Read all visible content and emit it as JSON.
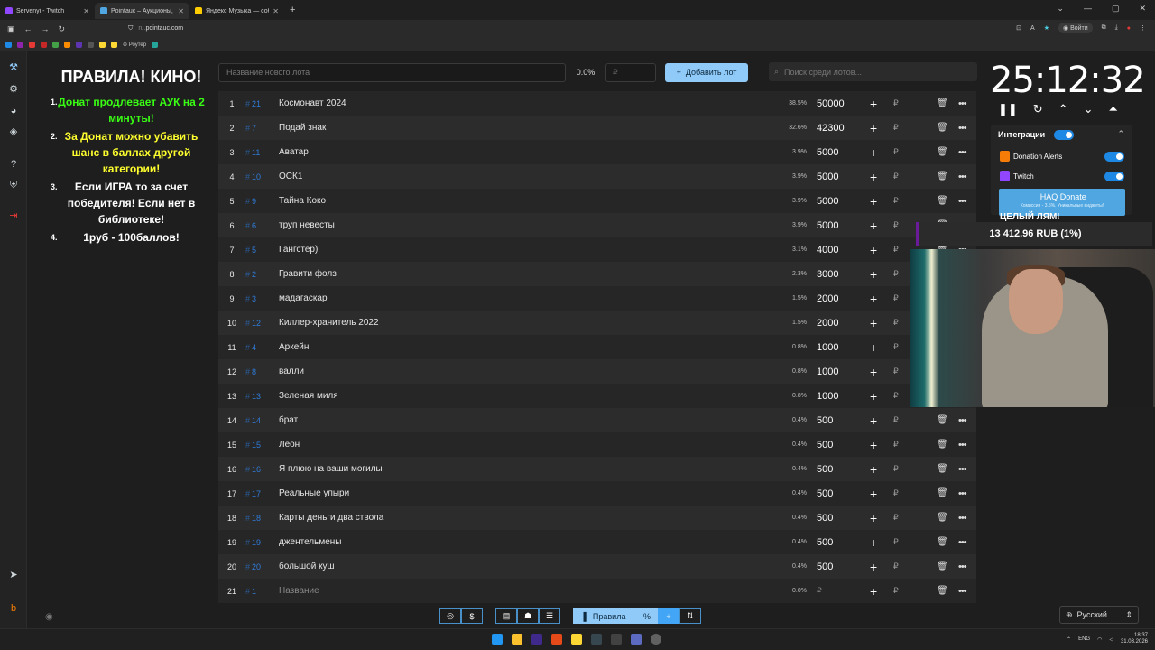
{
  "browser": {
    "tabs": [
      {
        "label": "Servenyi - Twitch",
        "color": "#9146ff"
      },
      {
        "label": "Pointauc – Аукционы, лотереи",
        "color": "#4fa6e0"
      },
      {
        "label": "Яндекс Музыка — собира",
        "color": "#ffcc00"
      }
    ],
    "url_prefix": "ru.",
    "url_domain": "pointauc.com",
    "login_label": "Войти",
    "bookmark_router": "Роутер"
  },
  "rules": {
    "title": "ПРАВИЛА! КИНО!",
    "items": [
      {
        "num": "1.",
        "a": "Донат продлевает АУК на 2 минуты!"
      },
      {
        "num": "2.",
        "a": "За Донат можно убавить шанс в баллах другой категории!"
      },
      {
        "num": "3.",
        "a": "Если ИГРА то за счет победителя! Если нет в библиотеке!"
      },
      {
        "num": "4.",
        "a": "1руб - 100баллов!"
      }
    ]
  },
  "toolbar": {
    "lot_placeholder": "Название нового лота",
    "percent": "0.0%",
    "amount_placeholder": "₽",
    "add_label": "Добавить лот",
    "search_placeholder": "Поиск среди лотов..."
  },
  "lots": [
    {
      "idx": "1",
      "id": "21",
      "name": "Космонавт 2024",
      "pct": "38.5%",
      "amount": "50000"
    },
    {
      "idx": "2",
      "id": "7",
      "name": "Подай знак",
      "pct": "32.6%",
      "amount": "42300"
    },
    {
      "idx": "3",
      "id": "11",
      "name": "Аватар",
      "pct": "3.9%",
      "amount": "5000"
    },
    {
      "idx": "4",
      "id": "10",
      "name": "ОСК1",
      "pct": "3.9%",
      "amount": "5000"
    },
    {
      "idx": "5",
      "id": "9",
      "name": "Тайна Коко",
      "pct": "3.9%",
      "amount": "5000"
    },
    {
      "idx": "6",
      "id": "6",
      "name": "труп невесты",
      "pct": "3.9%",
      "amount": "5000"
    },
    {
      "idx": "7",
      "id": "5",
      "name": "Гангстер)",
      "pct": "3.1%",
      "amount": "4000"
    },
    {
      "idx": "8",
      "id": "2",
      "name": "Гравити фолз",
      "pct": "2.3%",
      "amount": "3000"
    },
    {
      "idx": "9",
      "id": "3",
      "name": "мадагаскар",
      "pct": "1.5%",
      "amount": "2000"
    },
    {
      "idx": "10",
      "id": "12",
      "name": "Киллер-хранитель 2022",
      "pct": "1.5%",
      "amount": "2000"
    },
    {
      "idx": "11",
      "id": "4",
      "name": "Аркейн",
      "pct": "0.8%",
      "amount": "1000"
    },
    {
      "idx": "12",
      "id": "8",
      "name": "валли",
      "pct": "0.8%",
      "amount": "1000"
    },
    {
      "idx": "13",
      "id": "13",
      "name": "Зеленая миля",
      "pct": "0.8%",
      "amount": "1000"
    },
    {
      "idx": "14",
      "id": "14",
      "name": "брат",
      "pct": "0.4%",
      "amount": "500"
    },
    {
      "idx": "15",
      "id": "15",
      "name": "Леон",
      "pct": "0.4%",
      "amount": "500"
    },
    {
      "idx": "16",
      "id": "16",
      "name": "Я плюю на ваши могилы",
      "pct": "0.4%",
      "amount": "500"
    },
    {
      "idx": "17",
      "id": "17",
      "name": "Реальные упыри",
      "pct": "0.4%",
      "amount": "500"
    },
    {
      "idx": "18",
      "id": "18",
      "name": "Карты деньги два ствола",
      "pct": "0.4%",
      "amount": "500"
    },
    {
      "idx": "19",
      "id": "19",
      "name": "джентельмены",
      "pct": "0.4%",
      "amount": "500"
    },
    {
      "idx": "20",
      "id": "20",
      "name": "большой куш",
      "pct": "0.4%",
      "amount": "500"
    },
    {
      "idx": "21",
      "id": "1",
      "name": "Название",
      "pct": "0.0%",
      "amount": "₽"
    }
  ],
  "timer": {
    "value": "25:12:32"
  },
  "integrations": {
    "title": "Интеграции",
    "donation_alerts": "Donation Alerts",
    "twitch": "Twitch",
    "ihaq_title": "IHAQ Donate",
    "ihaq_sub": "Комиссия - 3.5%. Уникальные виджеты!"
  },
  "overlay": {
    "goal": "ЦЕЛЫЙ ЛЯМ!",
    "donation": "13 412.96 RUB (1%)"
  },
  "bottom": {
    "rules_label": "Правила",
    "percent_sign": "%",
    "dollar_sign": "$"
  },
  "language": "Русский",
  "taskbar": {
    "lang": "ENG",
    "time": "18:37",
    "date": "31.03.2026"
  },
  "colors": {
    "accent": "#90caf9",
    "rule_green": "#39ff14",
    "rule_yellow": "#ffff2e",
    "id_blue": "#2f7bd8"
  }
}
